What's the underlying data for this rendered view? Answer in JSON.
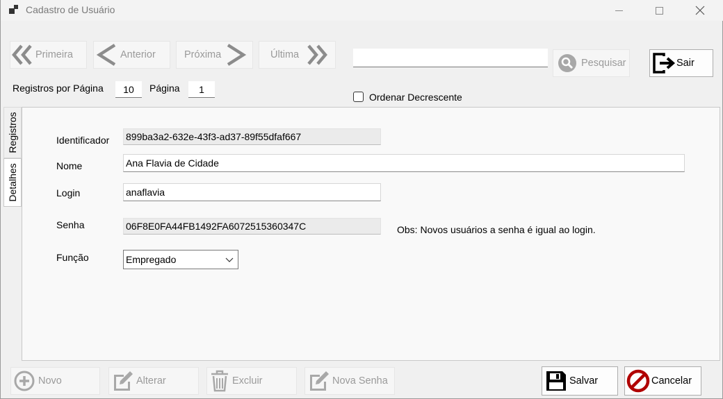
{
  "window": {
    "title": "Cadastro de Usuário"
  },
  "nav": {
    "first": "Primeira",
    "previous": "Anterior",
    "next": "Próxima",
    "last": "Última"
  },
  "search": {
    "value": "",
    "button": "Pesquisar"
  },
  "exit_button": "Sair",
  "paging": {
    "records_label": "Registros por Página",
    "records_value": "10",
    "page_label": "Página",
    "page_value": "1",
    "order_desc_label": "Ordenar Decrescente",
    "order_desc_checked": false
  },
  "tabs": {
    "records": "Registros",
    "details": "Detalhes"
  },
  "form": {
    "id_label": "Identificador",
    "id_value": "899ba3a2-632e-43f3-ad37-89f55dfaf667",
    "name_label": "Nome",
    "name_value": "Ana Flavia de Cidade",
    "login_label": "Login",
    "login_value": "anaflavia",
    "password_label": "Senha",
    "password_value": "06F8E0FA44FB1492FA6072515360347C",
    "password_note": "Obs: Novos usuários a senha é igual ao login.",
    "role_label": "Função",
    "role_value": "Empregado"
  },
  "actions": {
    "new": "Novo",
    "edit": "Alterar",
    "delete": "Excluir",
    "new_password": "Nova Senha",
    "save": "Salvar",
    "cancel": "Cancelar"
  },
  "colors": {
    "disabled_text": "#9a9a9a",
    "cancel_red": "#b00000"
  }
}
